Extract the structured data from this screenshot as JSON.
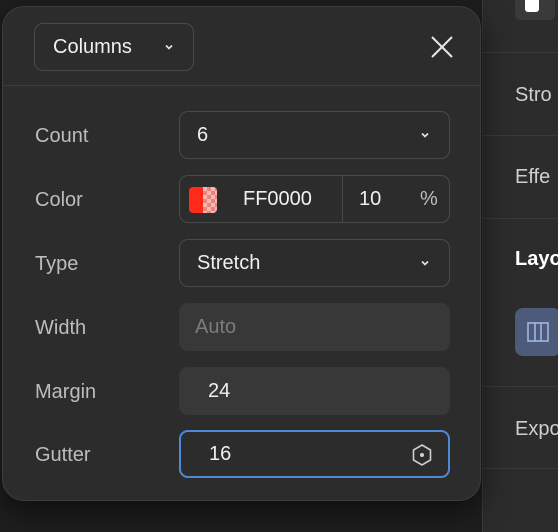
{
  "popover": {
    "mode": "Columns",
    "rows": {
      "count": {
        "label": "Count",
        "value": "6"
      },
      "color": {
        "label": "Color",
        "hex": "FF0000",
        "opacity": "10",
        "unit": "%",
        "swatch": "#ff2a1a"
      },
      "type": {
        "label": "Type",
        "value": "Stretch"
      },
      "width": {
        "label": "Width",
        "placeholder": "Auto"
      },
      "margin": {
        "label": "Margin",
        "value": "24"
      },
      "gutter": {
        "label": "Gutter",
        "value": "16"
      }
    }
  },
  "side_panel": {
    "labels": [
      "Stro",
      "Effe",
      "Layo",
      "Expo"
    ]
  },
  "colors": {
    "accent": "#4f8ad8",
    "panel": "#2c2c2c",
    "layout_button": "#4e5a7a"
  }
}
